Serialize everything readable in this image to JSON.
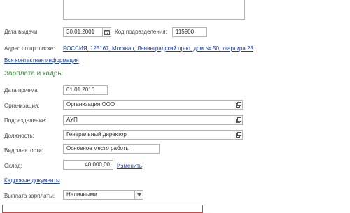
{
  "passport": {
    "issue_date_label": "Дата выдачи:",
    "issue_date_value": "30.01.2001",
    "dept_code_label": "Код подразделения:",
    "dept_code_value": "115900"
  },
  "address": {
    "label": "Адрес по прописке:",
    "value": "РОССИЯ, 125167, Москва г, Ленинградский пр-кт, дом № 50, квартира 23",
    "all_contacts_link": "Вся контактная информация"
  },
  "salary_section": {
    "title": "Зарплата и кадры",
    "hire_date_label": "Дата приема:",
    "hire_date_value": "01.01.2010",
    "org_label": "Организация:",
    "org_value": "Организация ООО",
    "division_label": "Подразделение:",
    "division_value": "АУП",
    "position_label": "Должность:",
    "position_value": "Генеральный директор",
    "employment_label": "Вид занятости:",
    "employment_value": "Основное место работы",
    "salary_label": "Оклад:",
    "salary_value": "40 000,00",
    "change_link": "Изменить",
    "hr_docs_link": "Кадровые документы",
    "payment_label": "Выплата зарплаты:",
    "payment_value": "Наличными"
  },
  "colors": {
    "section_title": "#3a8f3a",
    "link": "#1a3fa3",
    "field_border": "#b4b4b4",
    "error_border": "#e04040"
  },
  "icons": {
    "calendar": "calendar-icon",
    "open": "open-form-icon",
    "dropdown": "chevron-down-icon"
  }
}
